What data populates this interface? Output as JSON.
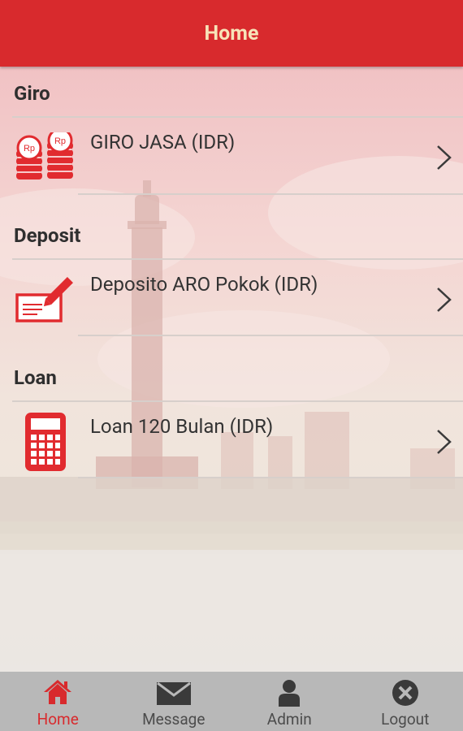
{
  "header": {
    "title": "Home"
  },
  "sections": [
    {
      "title": "Giro",
      "item": {
        "label": "GIRO JASA (IDR)",
        "icon": "coins-icon"
      }
    },
    {
      "title": "Deposit",
      "item": {
        "label": "Deposito ARO Pokok (IDR)",
        "icon": "check-pen-icon"
      }
    },
    {
      "title": "Loan",
      "item": {
        "label": "Loan 120 Bulan (IDR)",
        "icon": "calculator-icon"
      }
    }
  ],
  "coin_text": "Rp",
  "tabs": [
    {
      "label": "Home",
      "icon": "home-icon",
      "active": true
    },
    {
      "label": "Message",
      "icon": "envelope-icon",
      "active": false
    },
    {
      "label": "Admin",
      "icon": "person-icon",
      "active": false
    },
    {
      "label": "Logout",
      "icon": "close-circle-icon",
      "active": false
    }
  ],
  "colors": {
    "brand_red": "#d82a2d",
    "header_text": "#f7e3b8",
    "tabbar_bg": "#b8b8b8",
    "tab_inactive": "#4c4c4c"
  }
}
